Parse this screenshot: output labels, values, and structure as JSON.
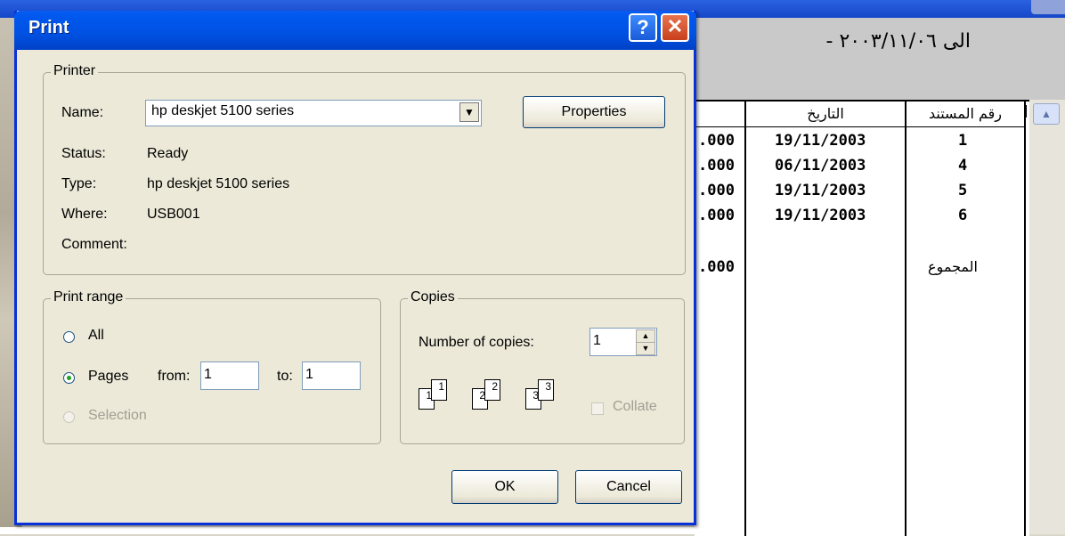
{
  "background": {
    "date_range": "الى ٢٠٠٣/١١/٠٦ -",
    "table": {
      "headers": [
        "رقم المستند",
        "التاريخ"
      ],
      "rows": [
        {
          "doc": "1",
          "date": "19/11/2003",
          "amount": ".000"
        },
        {
          "doc": "4",
          "date": "06/11/2003",
          "amount": ".000"
        },
        {
          "doc": "5",
          "date": "19/11/2003",
          "amount": ".000"
        },
        {
          "doc": "6",
          "date": "19/11/2003",
          "amount": ".000"
        }
      ],
      "total_label": "المجموع",
      "total_amount": ".000"
    }
  },
  "dialog": {
    "title": "Print",
    "help_glyph": "?",
    "close_glyph": "✕",
    "printer": {
      "group_label": "Printer",
      "name_label": "Name:",
      "name_value": "hp deskjet 5100 series",
      "properties_label": "Properties",
      "status_label": "Status:",
      "status_value": "Ready",
      "type_label": "Type:",
      "type_value": "hp deskjet 5100 series",
      "where_label": "Where:",
      "where_value": "USB001",
      "comment_label": "Comment:",
      "comment_value": ""
    },
    "print_range": {
      "group_label": "Print range",
      "all_label": "All",
      "pages_label": "Pages",
      "from_label": "from:",
      "from_value": "1",
      "to_label": "to:",
      "to_value": "1",
      "selection_label": "Selection",
      "selected": "Pages"
    },
    "copies": {
      "group_label": "Copies",
      "number_label": "Number of copies:",
      "number_value": "1",
      "collate_label": "Collate",
      "collate_checked": false,
      "page_icons": [
        [
          "1",
          "1"
        ],
        [
          "2",
          "2"
        ],
        [
          "3",
          "3"
        ]
      ]
    },
    "ok_label": "OK",
    "cancel_label": "Cancel"
  }
}
